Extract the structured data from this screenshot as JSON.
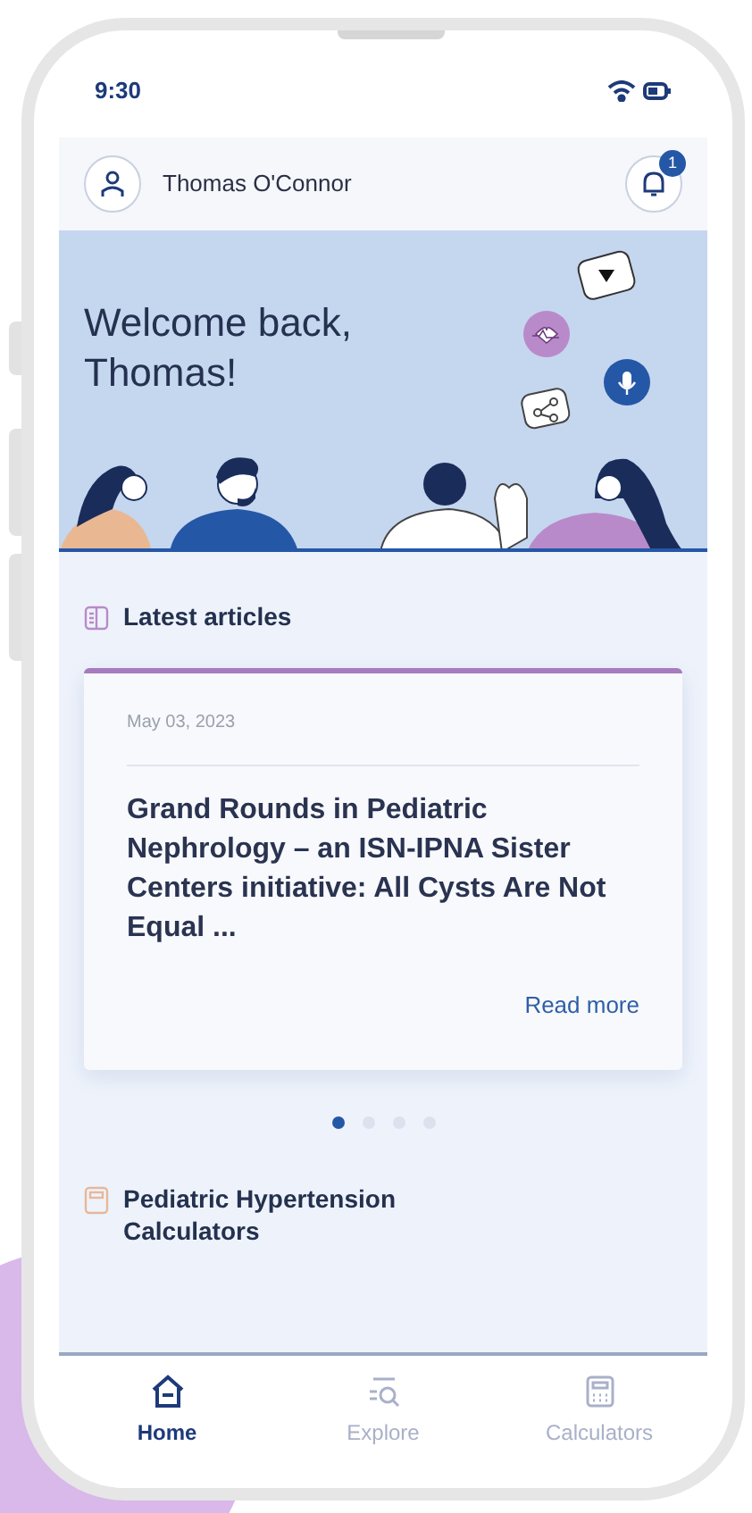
{
  "status_bar": {
    "time": "9:30"
  },
  "header": {
    "user_name": "Thomas O'Connor",
    "notification_badge": "1"
  },
  "banner": {
    "greeting": "Welcome back,\nThomas!"
  },
  "latest_articles": {
    "title": "Latest articles",
    "articles": [
      {
        "date": "May 03, 2023",
        "title": "Grand Rounds in Pediatric Nephrology – an ISN-IPNA Sister Centers initiative: All Cysts Are Not Equal ...",
        "link": "Read more"
      }
    ],
    "carousel_dots": [
      {
        "selected": true
      },
      {
        "selected": false
      },
      {
        "selected": false
      },
      {
        "selected": false
      }
    ]
  },
  "calculators_section": {
    "title": "Pediatric Hypertension Calculators"
  },
  "bottom_nav": [
    {
      "label": "Home",
      "kind": "home",
      "selected": true
    },
    {
      "label": "Explore",
      "kind": "explore",
      "selected": false
    },
    {
      "label": "Calculators",
      "kind": "calculator",
      "selected": false
    }
  ]
}
